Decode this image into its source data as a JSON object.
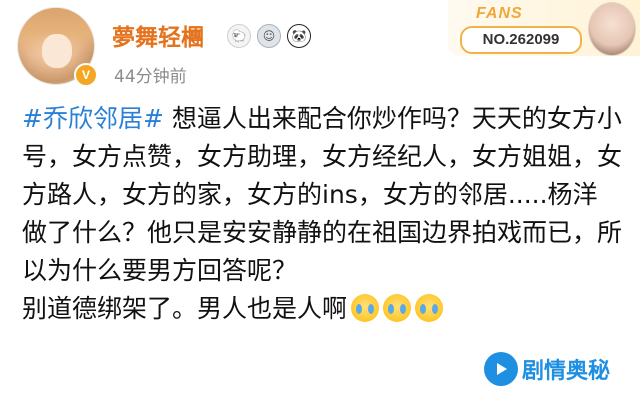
{
  "user": {
    "name": "夢舞轻檲",
    "verified_icon": "v-badge-icon",
    "badges": [
      {
        "icon": "sheep-icon",
        "glyph": "🐑"
      },
      {
        "icon": "medal-icon",
        "glyph": "☺"
      },
      {
        "icon": "panda-icon",
        "glyph": "🐼"
      }
    ],
    "timestamp": "44分钟前"
  },
  "fans_card": {
    "label": "FANS",
    "number": "NO.262099"
  },
  "post": {
    "topic": "#乔欣邻居#",
    "body": " 想逼人出来配合你炒作吗？天天的女方小号，女方点赞，女方助理，女方经纪人，女方姐姐，女方路人，女方的家，女方的ins，女方的邻居.....杨洋做了什么？他只是安安静静的在祖国边界拍戏而已，所以为什么要男方回答呢？",
    "last_line": "别道德绑架了。男人也是人啊",
    "emojis": [
      "crying-emoji",
      "crying-emoji",
      "crying-emoji"
    ]
  },
  "watermark": {
    "text": "剧情奥秘",
    "icon": "play-logo-icon"
  },
  "colors": {
    "username": "#e5731d",
    "topic": "#2a7fd6",
    "fans_accent": "#f0a73a",
    "watermark": "#1e8fe1"
  }
}
